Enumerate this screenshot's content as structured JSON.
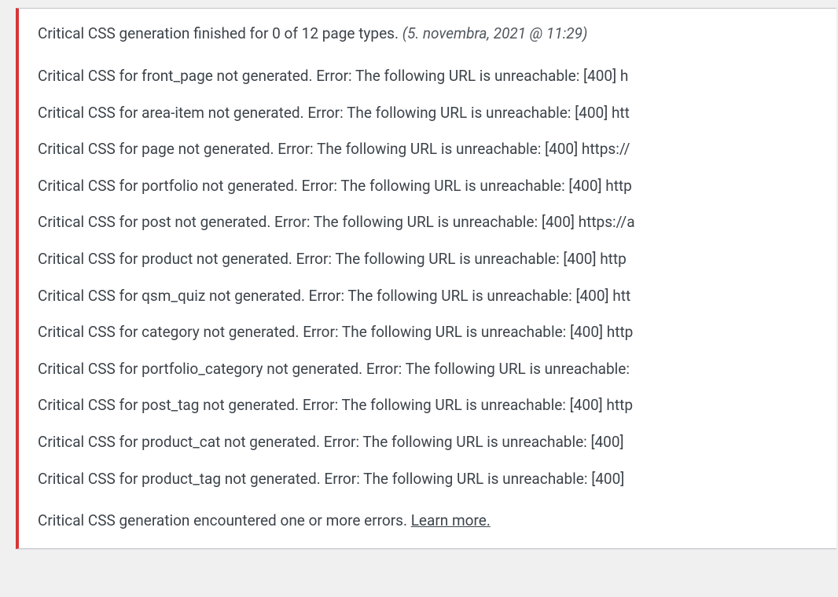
{
  "header": {
    "text": "Critical CSS generation finished for 0 of 12 page types. ",
    "timestamp": "(5. novembra, 2021 @ 11:29)"
  },
  "errors": [
    "Critical CSS for front_page not generated. Error: The following URL is unreachable: [400] h",
    "Critical CSS for area-item not generated. Error: The following URL is unreachable: [400] htt",
    "Critical CSS for page not generated. Error: The following URL is unreachable: [400] https://",
    "Critical CSS for portfolio not generated. Error: The following URL is unreachable: [400] http",
    "Critical CSS for post not generated. Error: The following URL is unreachable: [400] https://a",
    "Critical CSS for product not generated. Error: The following URL is unreachable: [400] http",
    "Critical CSS for qsm_quiz not generated. Error: The following URL is unreachable: [400] htt",
    "Critical CSS for category not generated. Error: The following URL is unreachable: [400] http",
    "Critical CSS for portfolio_category not generated. Error: The following URL is unreachable: ",
    "Critical CSS for post_tag not generated. Error: The following URL is unreachable: [400] http",
    "Critical CSS for product_cat not generated. Error: The following URL is unreachable: [400] ",
    "Critical CSS for product_tag not generated. Error: The following URL is unreachable: [400] "
  ],
  "footer": {
    "text": "Critical CSS generation encountered one or more errors. ",
    "link": "Learn more."
  }
}
